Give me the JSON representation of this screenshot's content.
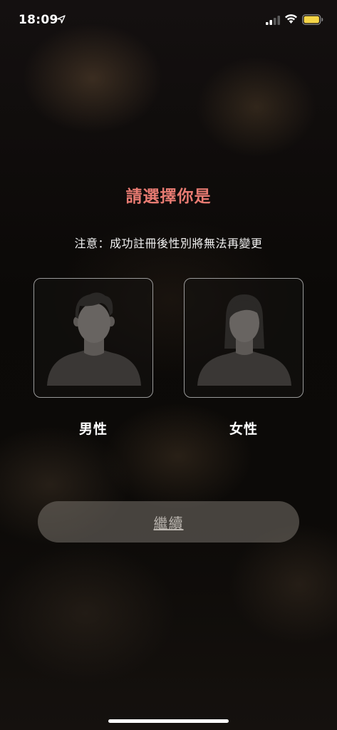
{
  "status_bar": {
    "time": "18:09",
    "icons": [
      "location-arrow-icon",
      "cellular-signal-icon",
      "wifi-icon",
      "battery-icon"
    ],
    "battery_color": "#f5d547"
  },
  "title": "請選擇你是",
  "notice": "注意：成功註冊後性別將無法再變更",
  "genders": [
    {
      "label": "男性",
      "icon": "male-avatar-icon"
    },
    {
      "label": "女性",
      "icon": "female-avatar-icon"
    }
  ],
  "continue_label": "繼續",
  "colors": {
    "title": "#e87b72",
    "card_border": "#9a9a9a",
    "button_bg": "#78726c"
  }
}
